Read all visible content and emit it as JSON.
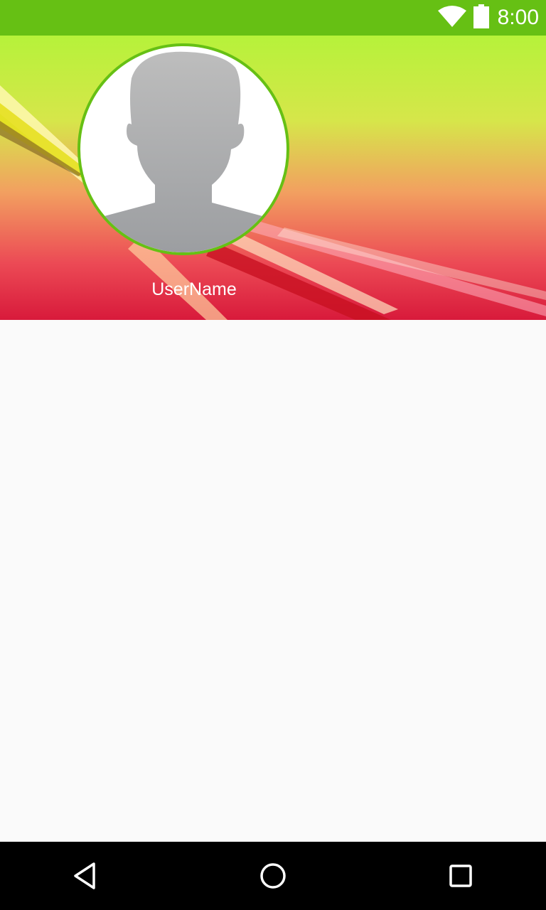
{
  "status_bar": {
    "time": "8:00",
    "icons": [
      "wifi-icon",
      "battery-icon"
    ],
    "background": "#66c014"
  },
  "header": {
    "username": "UserName",
    "avatar_icon": "person-silhouette-icon",
    "avatar_border_color": "#66c014"
  },
  "nav_bar": {
    "buttons": [
      "back-icon",
      "home-icon",
      "recents-icon"
    ]
  }
}
